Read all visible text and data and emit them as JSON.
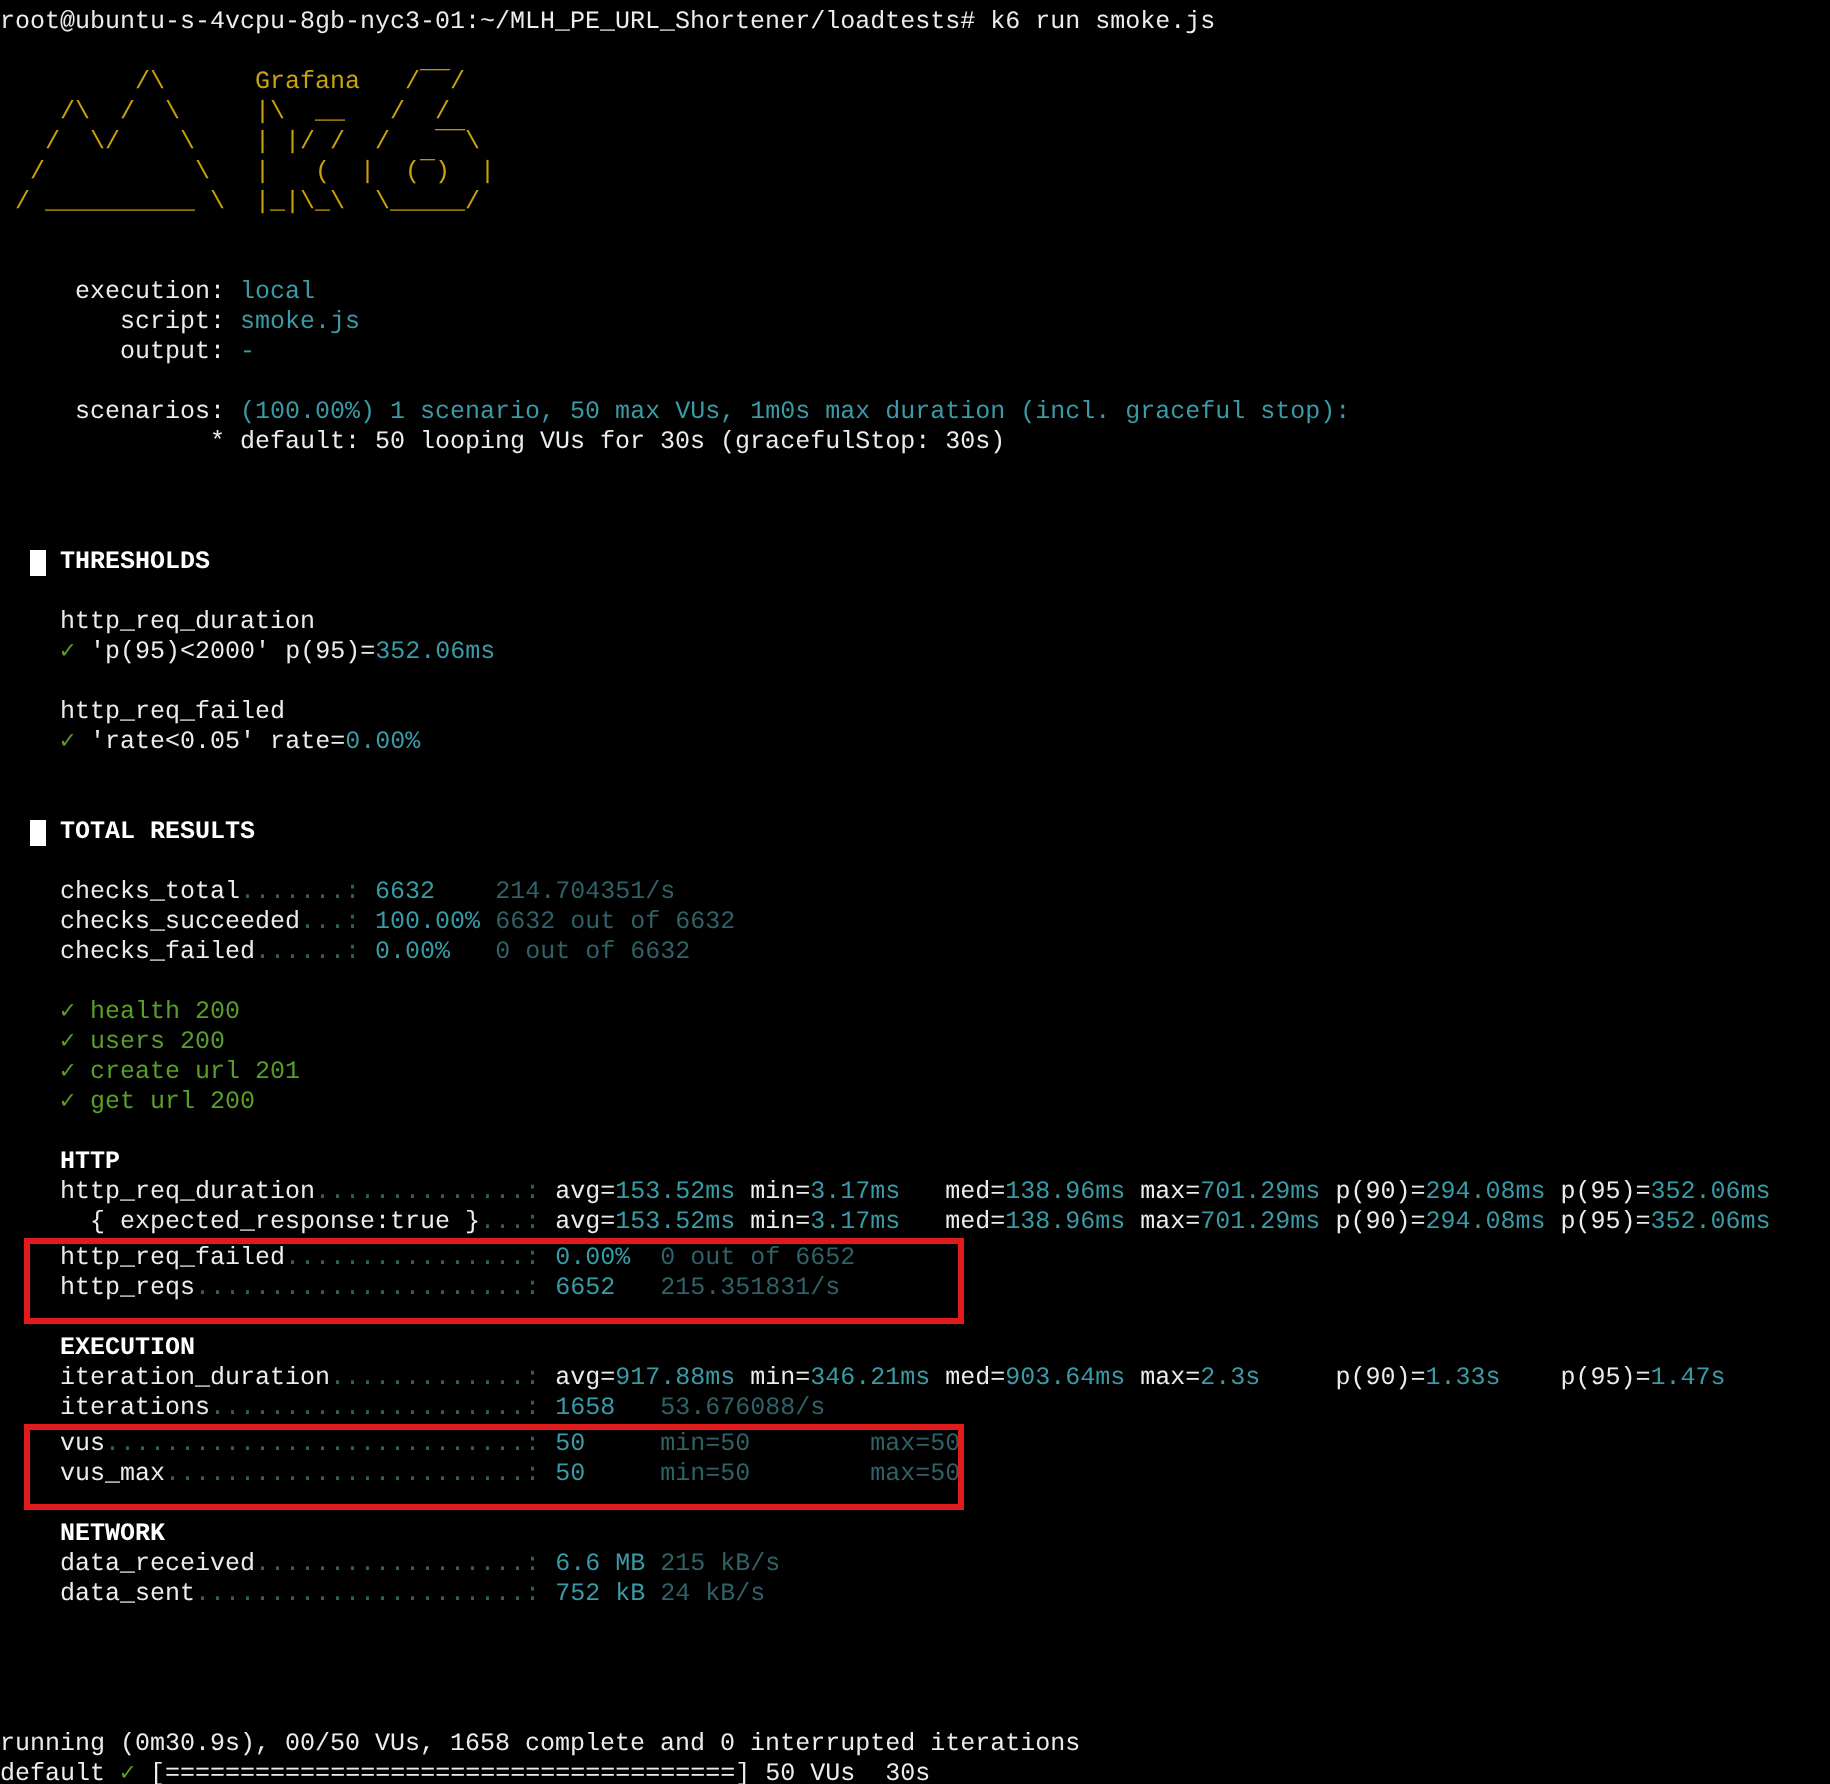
{
  "terminal": {
    "lines": [
      {
        "kind": "prompt",
        "segments": [
          {
            "text": "root@ubuntu-s-4vcpu-8gb-nyc3-01:~/MLH_PE_URL_Shortener/loadtests# k6 run smoke.js",
            "kind": "label"
          }
        ]
      },
      {
        "kind": "blank"
      },
      {
        "kind": "logo",
        "segments": [
          {
            "text": "         /\\      Grafana   /‾‾/",
            "kind": "logo"
          }
        ]
      },
      {
        "kind": "logo",
        "segments": [
          {
            "text": "    /\\  /  \\     |\\  __   /  /",
            "kind": "logo"
          }
        ]
      },
      {
        "kind": "logo",
        "segments": [
          {
            "text": "   /  \\/    \\    | |/ /  /   ‾‾\\",
            "kind": "logo"
          }
        ]
      },
      {
        "kind": "logo",
        "segments": [
          {
            "text": "  /          \\   |   (  |  (‾)  |",
            "kind": "logo"
          }
        ]
      },
      {
        "kind": "logo",
        "segments": [
          {
            "text": " / __________ \\  |_|\\_\\  \\_____/",
            "kind": "logo"
          }
        ]
      },
      {
        "kind": "blank"
      },
      {
        "kind": "blank"
      },
      {
        "kind": "text",
        "segments": [
          {
            "text": "     execution: ",
            "kind": "label"
          },
          {
            "text": "local",
            "kind": "value"
          }
        ]
      },
      {
        "kind": "text",
        "segments": [
          {
            "text": "        script: ",
            "kind": "label"
          },
          {
            "text": "smoke.js",
            "kind": "value"
          }
        ]
      },
      {
        "kind": "text",
        "segments": [
          {
            "text": "        output: ",
            "kind": "label"
          },
          {
            "text": "-",
            "kind": "value"
          }
        ]
      },
      {
        "kind": "blank"
      },
      {
        "kind": "text",
        "segments": [
          {
            "text": "     scenarios: ",
            "kind": "label"
          },
          {
            "text": "(100.00%) 1 scenario, 50 max VUs, 1m0s max duration (incl. graceful stop):",
            "kind": "value"
          }
        ]
      },
      {
        "kind": "text",
        "segments": [
          {
            "text": "              * default: 50 looping VUs for 30s (gracefulStop: 30s)",
            "kind": "label"
          }
        ]
      },
      {
        "kind": "blank"
      },
      {
        "kind": "blank"
      },
      {
        "kind": "blank"
      },
      {
        "kind": "heading",
        "text": "THRESHOLDS"
      },
      {
        "kind": "blank"
      },
      {
        "kind": "text",
        "segments": [
          {
            "text": "    http_req_duration",
            "kind": "label"
          }
        ]
      },
      {
        "kind": "text",
        "segments": [
          {
            "text": "    ✓ ",
            "kind": "ok"
          },
          {
            "text": "'p(95)<2000' p(95)=",
            "kind": "label"
          },
          {
            "text": "352.06ms",
            "kind": "value"
          }
        ]
      },
      {
        "kind": "blank"
      },
      {
        "kind": "text",
        "segments": [
          {
            "text": "    http_req_failed",
            "kind": "label"
          }
        ]
      },
      {
        "kind": "text",
        "segments": [
          {
            "text": "    ✓ ",
            "kind": "ok"
          },
          {
            "text": "'rate<0.05' rate=",
            "kind": "label"
          },
          {
            "text": "0.00%",
            "kind": "value"
          }
        ]
      },
      {
        "kind": "blank"
      },
      {
        "kind": "blank"
      },
      {
        "kind": "heading",
        "text": "TOTAL RESULTS"
      },
      {
        "kind": "blank"
      },
      {
        "kind": "text",
        "segments": [
          {
            "text": "    checks_total",
            "kind": "label"
          },
          {
            "text": ".......: ",
            "kind": "dim"
          },
          {
            "text": "6632",
            "kind": "value"
          },
          {
            "text": "    214.704351/s",
            "kind": "dim"
          }
        ]
      },
      {
        "kind": "text",
        "segments": [
          {
            "text": "    checks_succeeded",
            "kind": "label"
          },
          {
            "text": "...: ",
            "kind": "dim"
          },
          {
            "text": "100.00%",
            "kind": "value"
          },
          {
            "text": " 6632 out of 6632",
            "kind": "dim"
          }
        ]
      },
      {
        "kind": "text",
        "segments": [
          {
            "text": "    checks_failed",
            "kind": "label"
          },
          {
            "text": "......: ",
            "kind": "dim"
          },
          {
            "text": "0.00%",
            "kind": "value"
          },
          {
            "text": "   0 out of 6632",
            "kind": "dim"
          }
        ]
      },
      {
        "kind": "blank"
      },
      {
        "kind": "text",
        "segments": [
          {
            "text": "    ✓ health 200",
            "kind": "ok"
          }
        ]
      },
      {
        "kind": "text",
        "segments": [
          {
            "text": "    ✓ users 200",
            "kind": "ok"
          }
        ]
      },
      {
        "kind": "text",
        "segments": [
          {
            "text": "    ✓ create url 201",
            "kind": "ok"
          }
        ]
      },
      {
        "kind": "text",
        "segments": [
          {
            "text": "    ✓ get url 200",
            "kind": "ok"
          }
        ]
      },
      {
        "kind": "blank"
      },
      {
        "kind": "subheading",
        "text": "HTTP"
      },
      {
        "kind": "text",
        "segments": [
          {
            "text": "    http_req_duration",
            "kind": "label"
          },
          {
            "text": "..............: ",
            "kind": "dim"
          },
          {
            "text": "avg=",
            "kind": "label"
          },
          {
            "text": "153.52ms",
            "kind": "value"
          },
          {
            "text": " min=",
            "kind": "label"
          },
          {
            "text": "3.17ms",
            "kind": "value"
          },
          {
            "text": "   med=",
            "kind": "label"
          },
          {
            "text": "138.96ms",
            "kind": "value"
          },
          {
            "text": " max=",
            "kind": "label"
          },
          {
            "text": "701.29ms",
            "kind": "value"
          },
          {
            "text": " p(90)=",
            "kind": "label"
          },
          {
            "text": "294.08ms",
            "kind": "value"
          },
          {
            "text": " p(95)=",
            "kind": "label"
          },
          {
            "text": "352.06ms",
            "kind": "value"
          }
        ]
      },
      {
        "kind": "text",
        "segments": [
          {
            "text": "      { expected_response:true }",
            "kind": "label"
          },
          {
            "text": "...: ",
            "kind": "dim"
          },
          {
            "text": "avg=",
            "kind": "label"
          },
          {
            "text": "153.52ms",
            "kind": "value"
          },
          {
            "text": " min=",
            "kind": "label"
          },
          {
            "text": "3.17ms",
            "kind": "value"
          },
          {
            "text": "   med=",
            "kind": "label"
          },
          {
            "text": "138.96ms",
            "kind": "value"
          },
          {
            "text": " max=",
            "kind": "label"
          },
          {
            "text": "701.29ms",
            "kind": "value"
          },
          {
            "text": " p(90)=",
            "kind": "label"
          },
          {
            "text": "294.08ms",
            "kind": "value"
          },
          {
            "text": " p(95)=",
            "kind": "label"
          },
          {
            "text": "352.06ms",
            "kind": "value"
          }
        ]
      },
      {
        "kind": "highlight",
        "lines": [
          {
            "kind": "text",
            "segments": [
              {
                "text": "    http_req_failed",
                "kind": "label"
              },
              {
                "text": "................: ",
                "kind": "dim"
              },
              {
                "text": "0.00%",
                "kind": "value"
              },
              {
                "text": "  0 out of 6652",
                "kind": "dim"
              }
            ]
          },
          {
            "kind": "text",
            "segments": [
              {
                "text": "    http_reqs",
                "kind": "label"
              },
              {
                "text": "......................: ",
                "kind": "dim"
              },
              {
                "text": "6652",
                "kind": "value"
              },
              {
                "text": "   215.351831/s",
                "kind": "dim"
              }
            ]
          }
        ]
      },
      {
        "kind": "blank"
      },
      {
        "kind": "subheading",
        "text": "EXECUTION"
      },
      {
        "kind": "text",
        "segments": [
          {
            "text": "    iteration_duration",
            "kind": "label"
          },
          {
            "text": ".............: ",
            "kind": "dim"
          },
          {
            "text": "avg=",
            "kind": "label"
          },
          {
            "text": "917.88ms",
            "kind": "value"
          },
          {
            "text": " min=",
            "kind": "label"
          },
          {
            "text": "346.21ms",
            "kind": "value"
          },
          {
            "text": " med=",
            "kind": "label"
          },
          {
            "text": "903.64ms",
            "kind": "value"
          },
          {
            "text": " max=",
            "kind": "label"
          },
          {
            "text": "2.3s",
            "kind": "value"
          },
          {
            "text": "     p(90)=",
            "kind": "label"
          },
          {
            "text": "1.33s",
            "kind": "value"
          },
          {
            "text": "    p(95)=",
            "kind": "label"
          },
          {
            "text": "1.47s",
            "kind": "value"
          }
        ]
      },
      {
        "kind": "text",
        "segments": [
          {
            "text": "    iterations",
            "kind": "label"
          },
          {
            "text": ".....................: ",
            "kind": "dim"
          },
          {
            "text": "1658",
            "kind": "value"
          },
          {
            "text": "   53.676088/s",
            "kind": "dim"
          }
        ]
      },
      {
        "kind": "highlight",
        "lines": [
          {
            "kind": "text",
            "segments": [
              {
                "text": "    vus",
                "kind": "label"
              },
              {
                "text": "............................: ",
                "kind": "dim"
              },
              {
                "text": "50",
                "kind": "value"
              },
              {
                "text": "     min=50        max=50",
                "kind": "dim"
              }
            ]
          },
          {
            "kind": "text",
            "segments": [
              {
                "text": "    vus_max",
                "kind": "label"
              },
              {
                "text": "........................: ",
                "kind": "dim"
              },
              {
                "text": "50",
                "kind": "value"
              },
              {
                "text": "     min=50        max=50",
                "kind": "dim"
              }
            ]
          }
        ]
      },
      {
        "kind": "blank"
      },
      {
        "kind": "subheading",
        "text": "NETWORK"
      },
      {
        "kind": "text",
        "segments": [
          {
            "text": "    data_received",
            "kind": "label"
          },
          {
            "text": "..................: ",
            "kind": "dim"
          },
          {
            "text": "6.6 MB",
            "kind": "value"
          },
          {
            "text": " 215 kB/s",
            "kind": "dim"
          }
        ]
      },
      {
        "kind": "text",
        "segments": [
          {
            "text": "    data_sent",
            "kind": "label"
          },
          {
            "text": "......................: ",
            "kind": "dim"
          },
          {
            "text": "752 kB",
            "kind": "value"
          },
          {
            "text": " 24 kB/s",
            "kind": "dim"
          }
        ]
      },
      {
        "kind": "blank"
      },
      {
        "kind": "blank"
      },
      {
        "kind": "blank"
      },
      {
        "kind": "blank"
      },
      {
        "kind": "text",
        "segments": [
          {
            "text": "running (0m30.9s), 00/50 VUs, 1658 complete and 0 interrupted iterations",
            "kind": "label"
          }
        ]
      },
      {
        "kind": "text",
        "segments": [
          {
            "text": "default ",
            "kind": "label"
          },
          {
            "text": "✓",
            "kind": "ok"
          },
          {
            "text": " [======================================] 50 VUs  30s",
            "kind": "label"
          }
        ]
      }
    ]
  }
}
